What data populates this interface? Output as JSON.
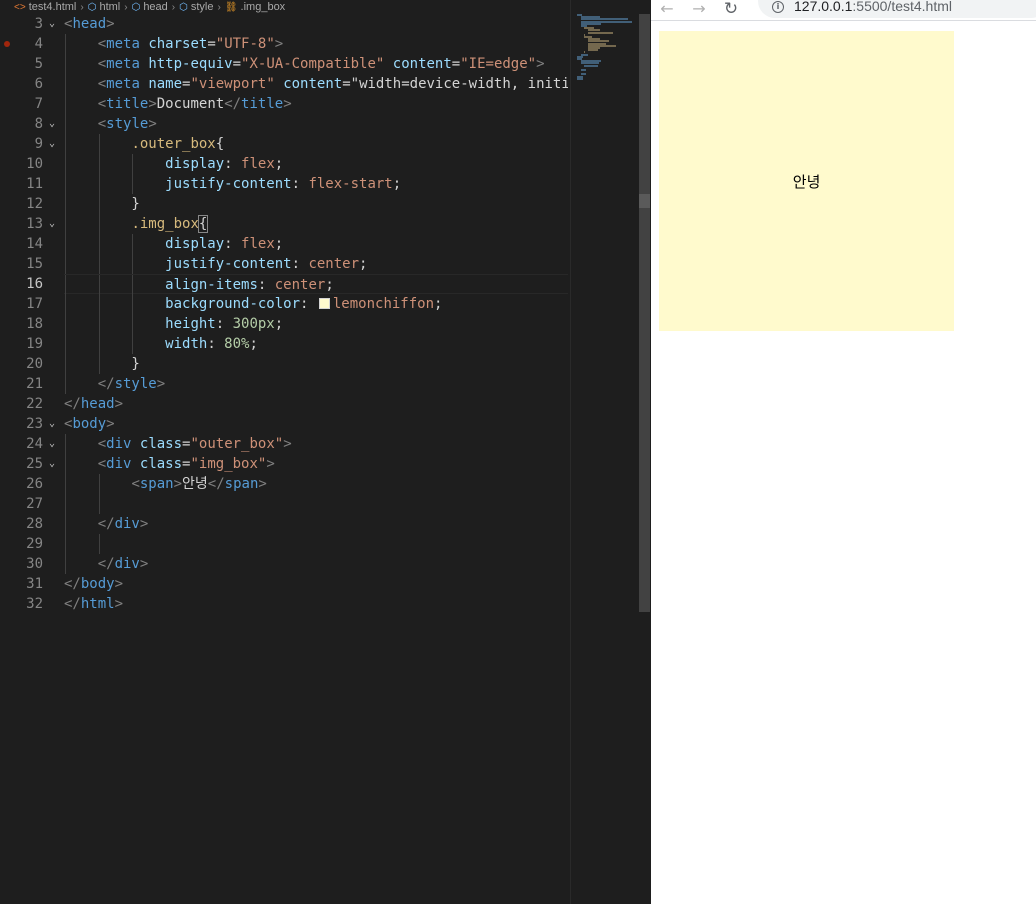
{
  "breadcrumb": {
    "file": "test4.html",
    "items": [
      "html",
      "head",
      "style"
    ],
    "selector": ".img_box"
  },
  "editor": {
    "active_line": 16,
    "lines": [
      {
        "n": "3",
        "code": "<head>"
      },
      {
        "n": "4",
        "code": "    <meta charset=\"UTF-8\">"
      },
      {
        "n": "5",
        "code": "    <meta http-equiv=\"X-UA-Compatible\" content=\"IE=edge\">"
      },
      {
        "n": "6",
        "code": "    <meta name=\"viewport\" content=\"width=device-width, initia"
      },
      {
        "n": "7",
        "code": "    <title>Document</title>"
      },
      {
        "n": "8",
        "code": "    <style>"
      },
      {
        "n": "9",
        "code": "        .outer_box{"
      },
      {
        "n": "10",
        "code": "            display: flex;"
      },
      {
        "n": "11",
        "code": "            justify-content: flex-start;"
      },
      {
        "n": "12",
        "code": "        }"
      },
      {
        "n": "13",
        "code": "        .img_box{"
      },
      {
        "n": "14",
        "code": "            display: flex;"
      },
      {
        "n": "15",
        "code": "            justify-content: center;"
      },
      {
        "n": "16",
        "code": "            align-items: center;"
      },
      {
        "n": "17",
        "code": "            background-color: lemonchiffon;"
      },
      {
        "n": "18",
        "code": "            height: 300px;"
      },
      {
        "n": "19",
        "code": "            width: 80%;"
      },
      {
        "n": "20",
        "code": "        }"
      },
      {
        "n": "21",
        "code": "    </style>"
      },
      {
        "n": "22",
        "code": "</head>"
      },
      {
        "n": "23",
        "code": "<body>"
      },
      {
        "n": "24",
        "code": "    <div class=\"outer_box\">"
      },
      {
        "n": "25",
        "code": "    <div class=\"img_box\">"
      },
      {
        "n": "26",
        "code": "        <span>안녕</span>"
      },
      {
        "n": "27",
        "code": ""
      },
      {
        "n": "28",
        "code": "    </div>"
      },
      {
        "n": "29",
        "code": ""
      },
      {
        "n": "30",
        "code": "    </div>"
      },
      {
        "n": "31",
        "code": "</body>"
      },
      {
        "n": "32",
        "code": "</html>"
      }
    ]
  },
  "browser": {
    "back_icon": "←",
    "forward_icon": "→",
    "reload_icon": "↻",
    "url_host": "127.0.0.1",
    "url_path": ":5500/test4.html",
    "box_text": "안녕"
  },
  "colors": {
    "lemonchiffon": "#fffacd",
    "editor_bg": "#1e1e1e"
  }
}
